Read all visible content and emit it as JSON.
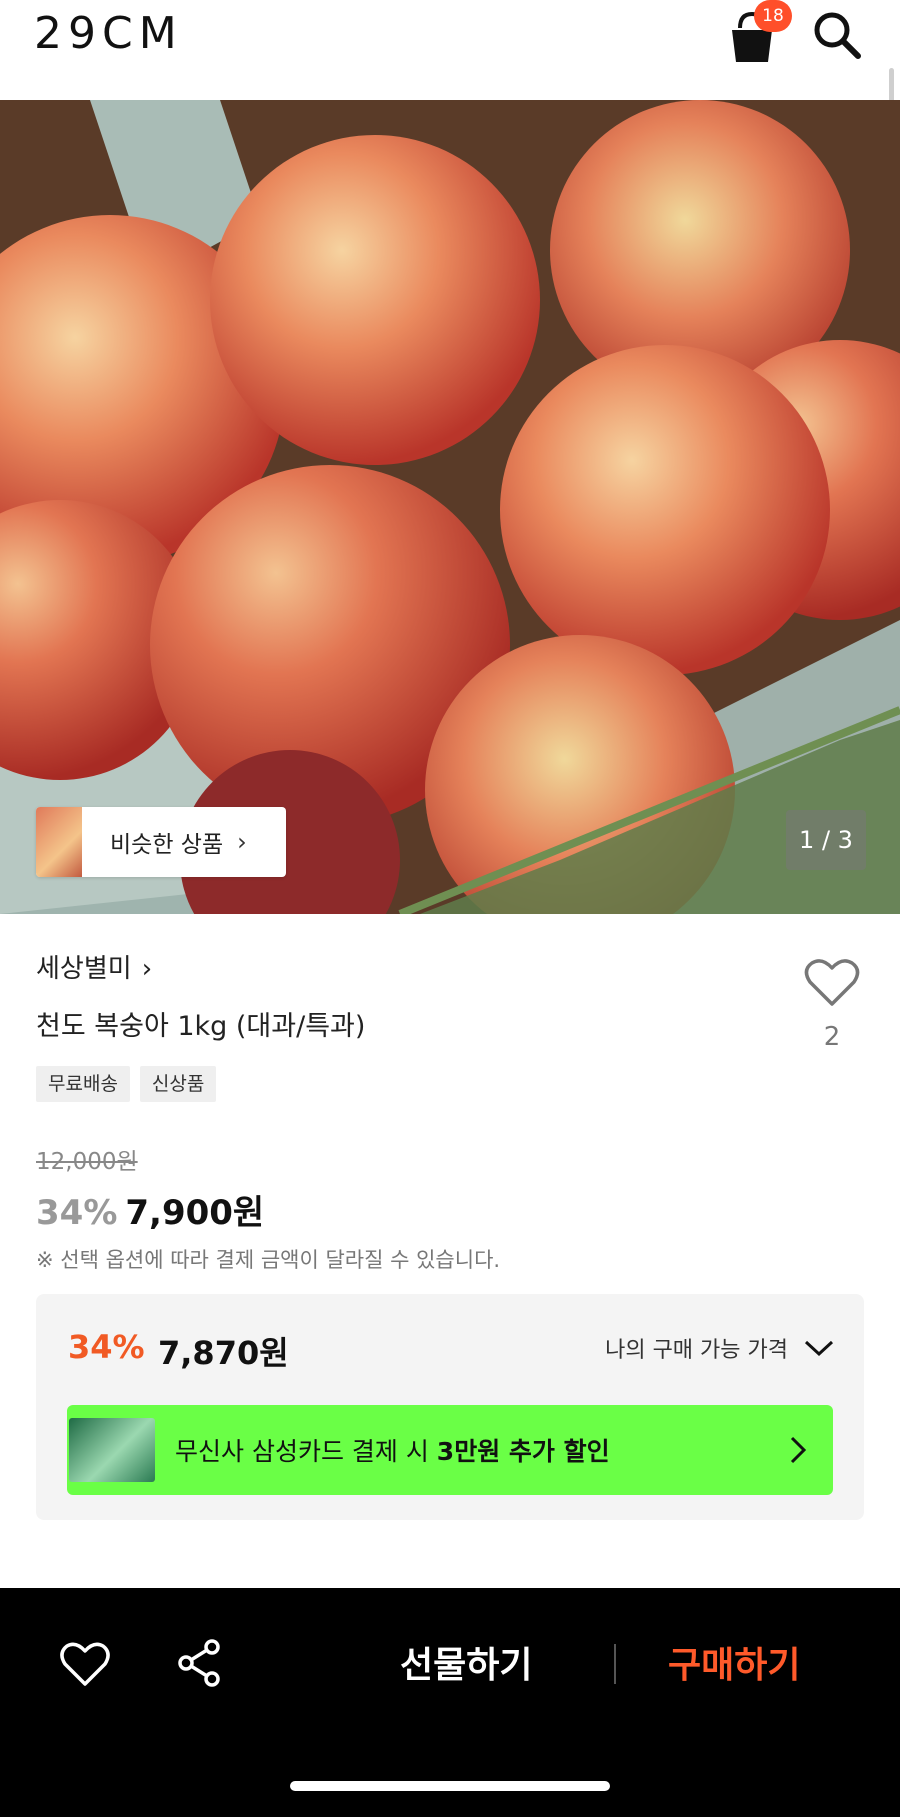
{
  "header": {
    "logo": "29CM",
    "cart_badge": "18"
  },
  "hero": {
    "similar_label": "비슷한 상품",
    "pager": "1 / 3"
  },
  "product": {
    "brand": "세상별미",
    "title": "천도 복숭아 1kg (대과/특과)",
    "like_count": "2",
    "tags": [
      "무료배송",
      "신상품"
    ],
    "original_price": "12,000원",
    "discount": "34%",
    "sale_price": "7,900원",
    "notice": "※ 선택 옵션에 따라 결제 금액이 달라질 수 있습니다."
  },
  "benefit": {
    "discount": "34%",
    "price": "7,870원",
    "my_price_label": "나의 구매 가능 가격",
    "card_text_prefix": "무신사 삼성카드 결제 시 ",
    "card_text_bold": "3만원 추가 할인"
  },
  "bottom_bar": {
    "gift_label": "선물하기",
    "buy_label": "구매하기"
  },
  "colors": {
    "accent": "#f15a24",
    "buy": "#ff5a2a",
    "card_banner": "#6aff46",
    "badge": "#ff4f2a"
  }
}
